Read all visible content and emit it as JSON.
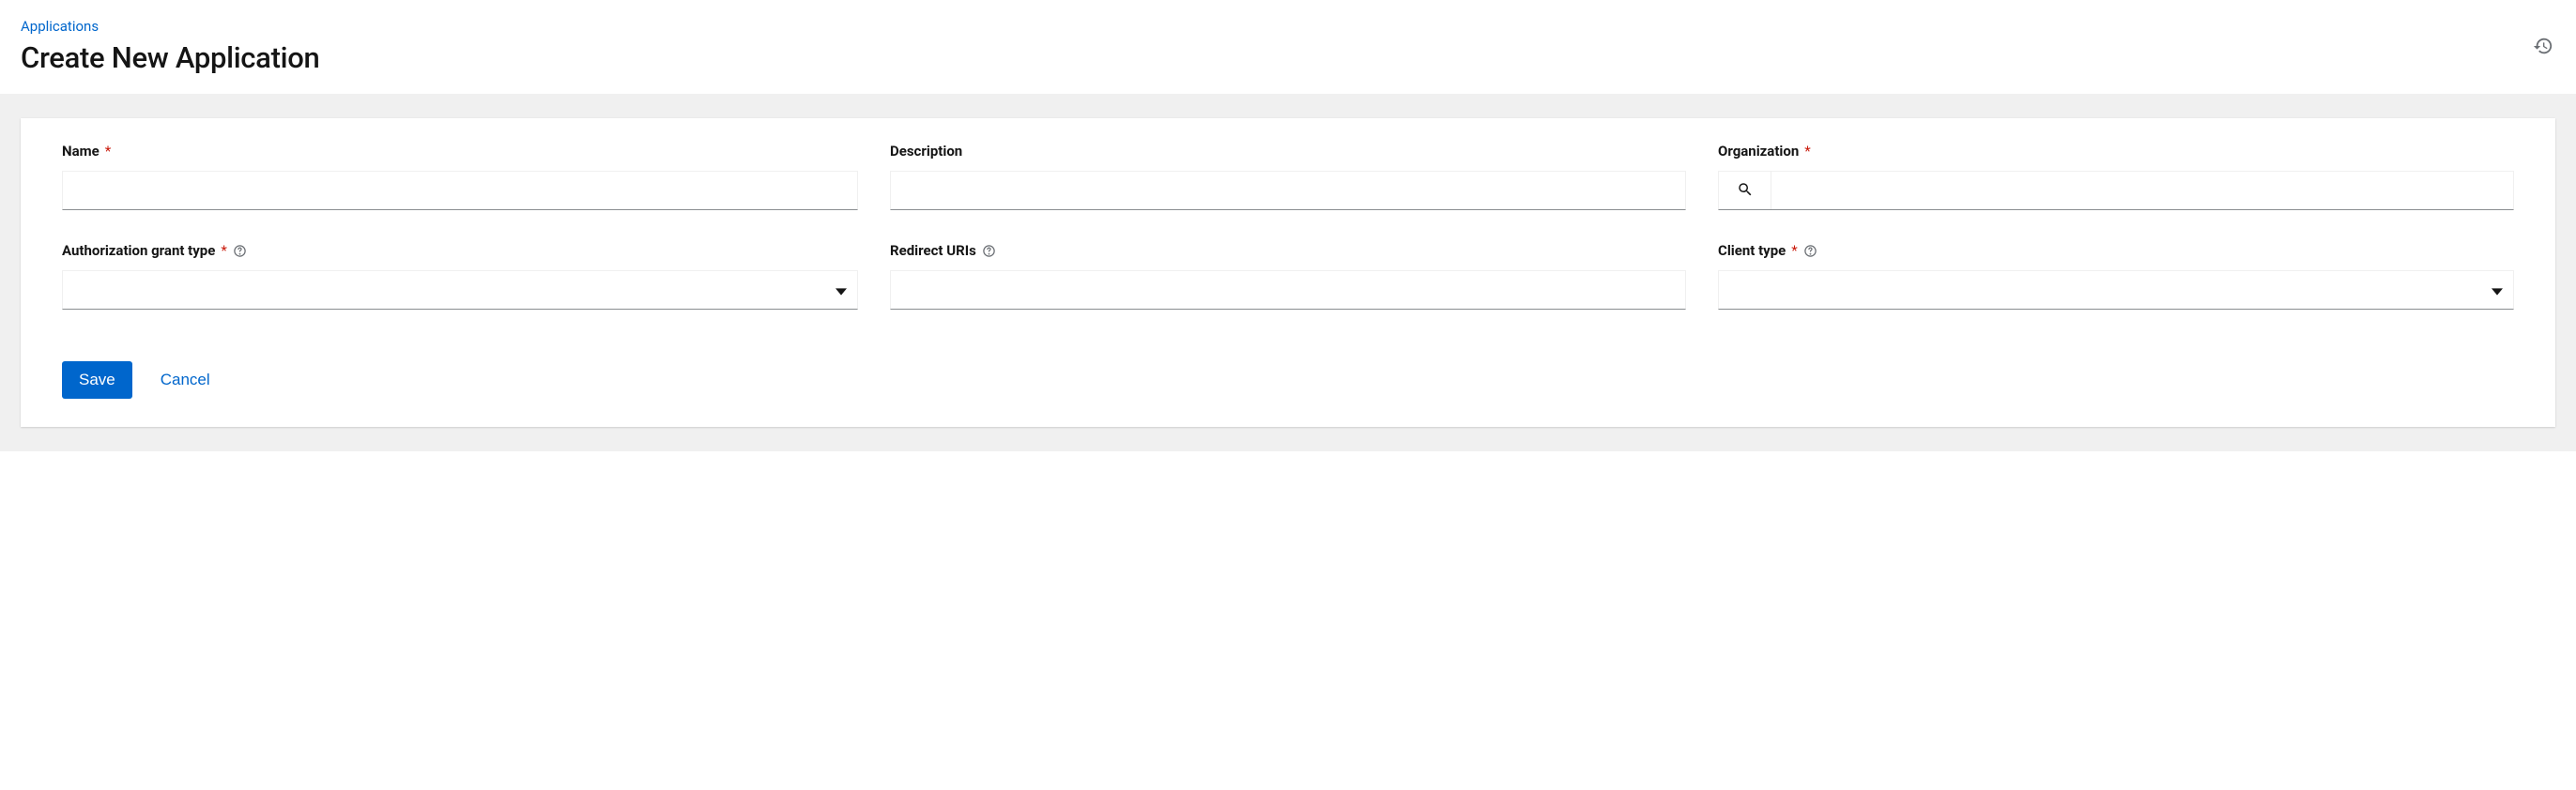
{
  "breadcrumb": {
    "parent": "Applications"
  },
  "page": {
    "title": "Create New Application"
  },
  "form": {
    "name": {
      "label": "Name",
      "required": true,
      "value": ""
    },
    "description": {
      "label": "Description",
      "required": false,
      "value": ""
    },
    "organization": {
      "label": "Organization",
      "required": true,
      "value": ""
    },
    "auth_grant_type": {
      "label": "Authorization grant type",
      "required": true,
      "has_help": true,
      "value": ""
    },
    "redirect_uris": {
      "label": "Redirect URIs",
      "required": false,
      "has_help": true,
      "value": ""
    },
    "client_type": {
      "label": "Client type",
      "required": true,
      "has_help": true,
      "value": ""
    }
  },
  "actions": {
    "save": "Save",
    "cancel": "Cancel"
  },
  "required_marker": "*"
}
